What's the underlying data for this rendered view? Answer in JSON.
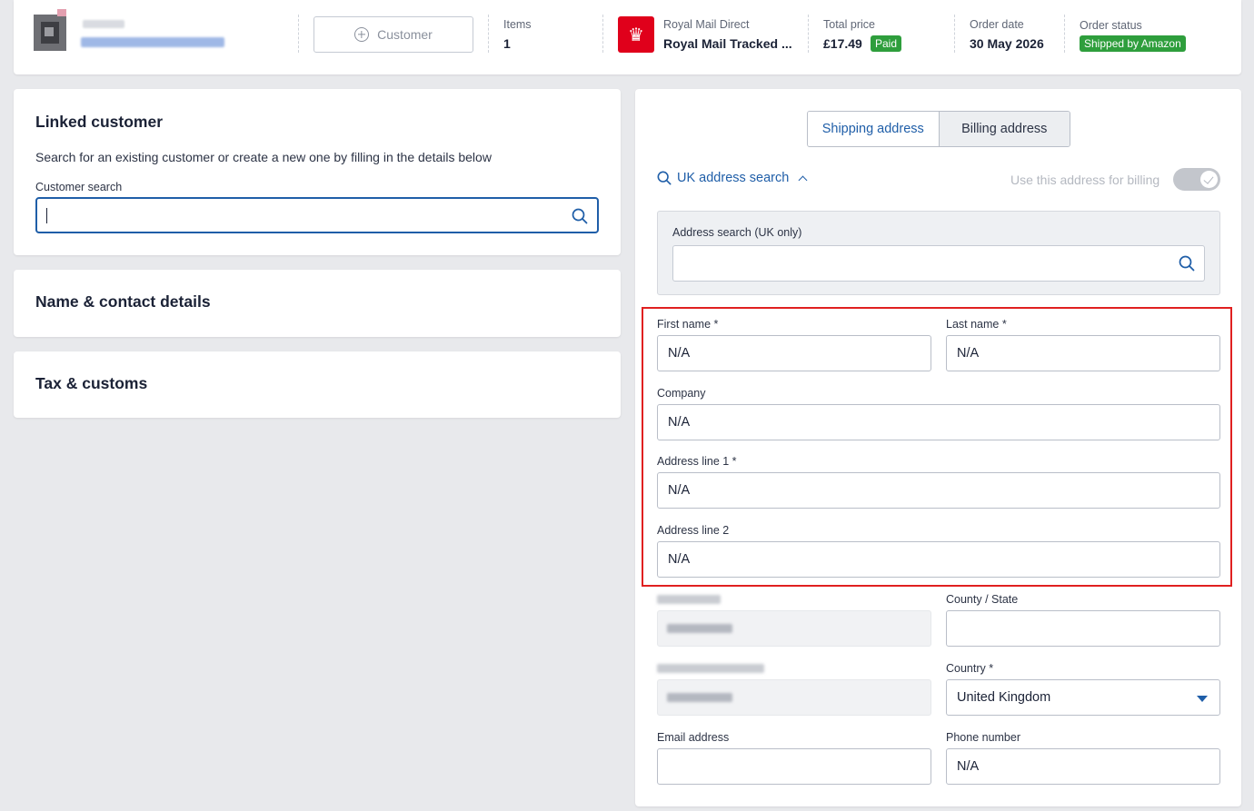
{
  "header": {
    "customer_button_label": "Customer",
    "items": {
      "label": "Items",
      "value": "1"
    },
    "carrier": {
      "label": "Royal Mail Direct",
      "value": "Royal Mail Tracked ..."
    },
    "total_price": {
      "label": "Total price",
      "value": "£17.49",
      "badge": "Paid"
    },
    "order_date": {
      "label": "Order date",
      "value": "30 May 2026"
    },
    "order_status": {
      "label": "Order status",
      "badge": "Shipped by Amazon"
    },
    "colors": {
      "paid_badge": "#2e9e3c",
      "status_badge": "#2e9e3c",
      "carrier_logo": "#e0001b"
    }
  },
  "linked_customer": {
    "title": "Linked customer",
    "description": "Search for an existing customer or create a new one by filling in the details below",
    "search_label": "Customer search",
    "search_value": ""
  },
  "sections": {
    "name_contact": "Name & contact details",
    "tax_customs": "Tax & customs"
  },
  "address": {
    "tabs": [
      {
        "label": "Shipping address",
        "active": true
      },
      {
        "label": "Billing address",
        "active": false
      }
    ],
    "uk_search_label": "UK address search",
    "use_for_billing_label": "Use this address for billing",
    "use_for_billing_enabled": true,
    "address_search_label": "Address search (UK only)",
    "address_search_value": "",
    "fields": {
      "first_name": {
        "label": "First name *",
        "value": "N/A"
      },
      "last_name": {
        "label": "Last name *",
        "value": "N/A"
      },
      "company": {
        "label": "Company",
        "value": "N/A"
      },
      "address_line_1": {
        "label": "Address line 1 *",
        "value": "N/A"
      },
      "address_line_2": {
        "label": "Address line 2",
        "value": "N/A"
      },
      "county_state": {
        "label": "County / State",
        "value": ""
      },
      "country": {
        "label": "Country *",
        "value": "United Kingdom"
      },
      "email": {
        "label": "Email address",
        "value": ""
      },
      "phone": {
        "label": "Phone number",
        "value": "N/A"
      }
    },
    "accent_color": "#1f5ea8",
    "highlight_color": "#e02020"
  }
}
